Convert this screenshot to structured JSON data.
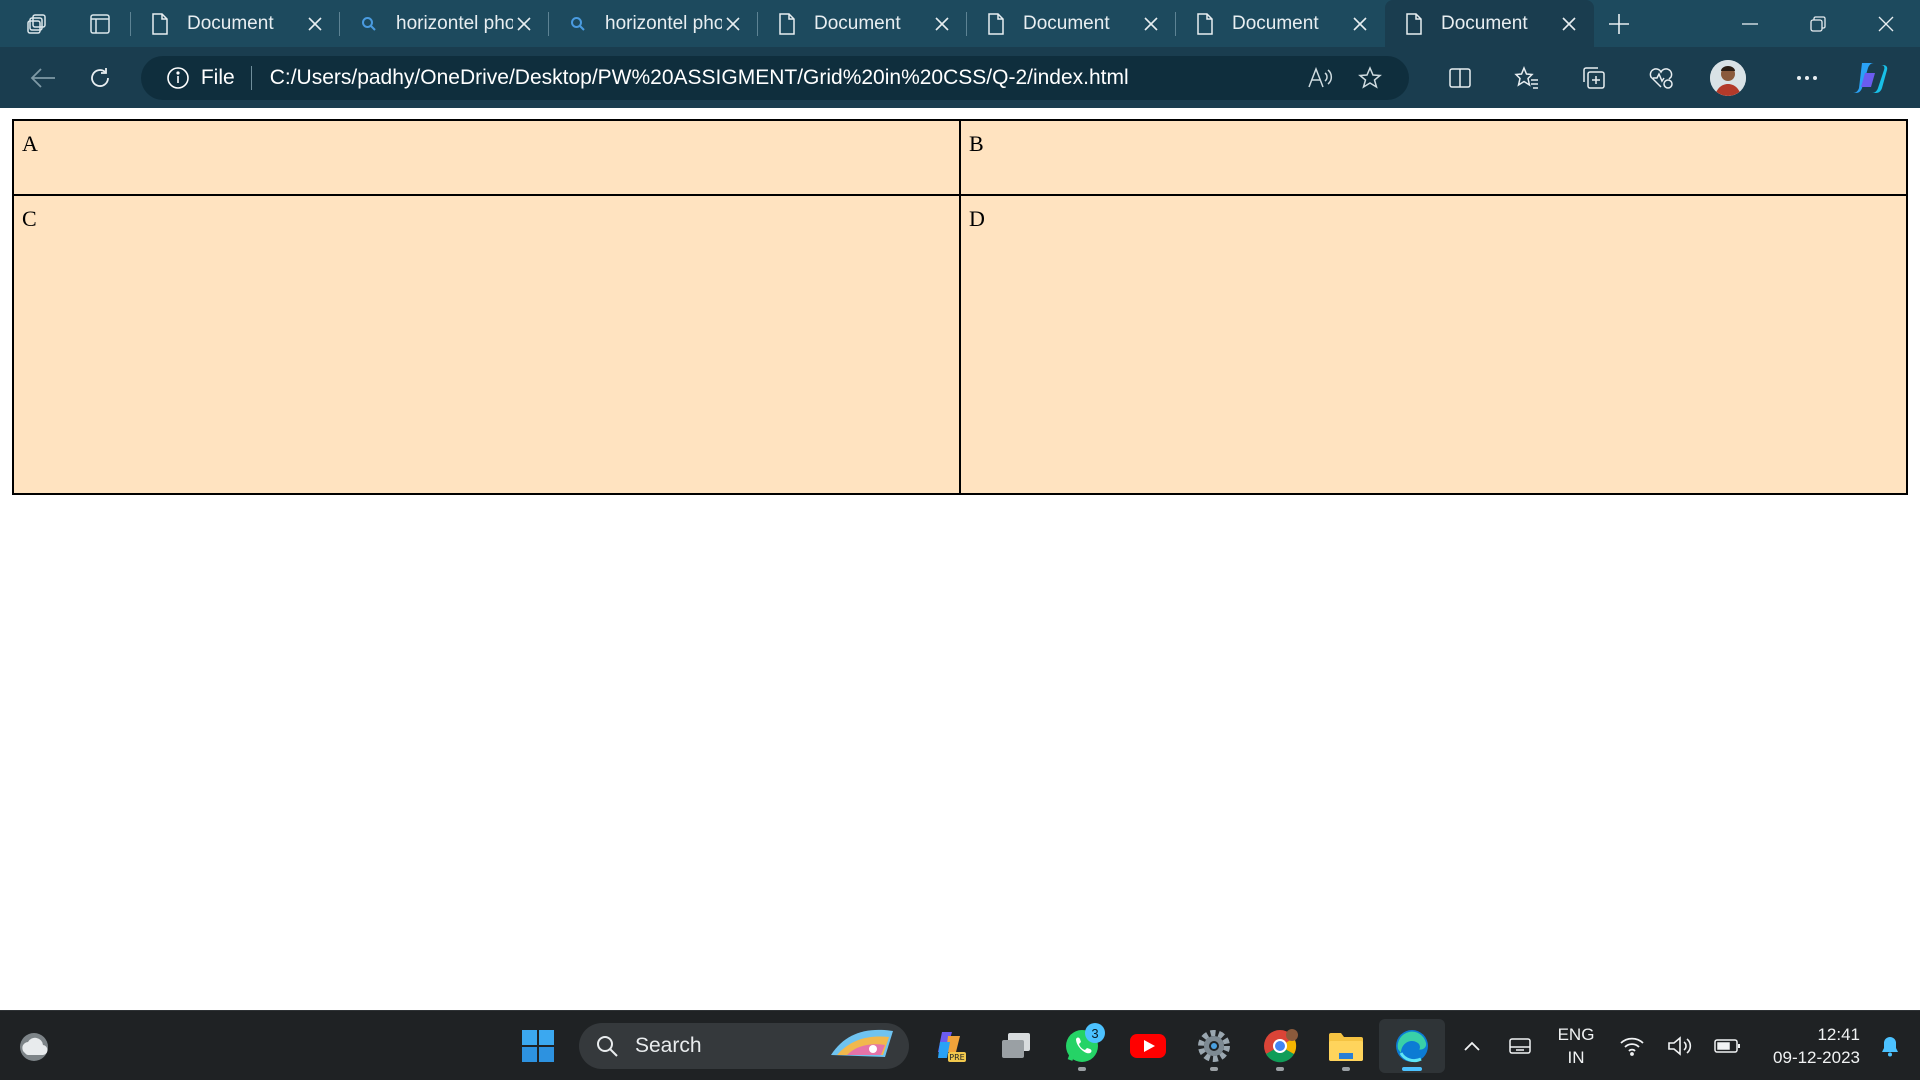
{
  "tabs": [
    {
      "label": "Document",
      "icon": "page-icon",
      "active": false
    },
    {
      "label": "horizontel photos",
      "icon": "search-icon",
      "active": false
    },
    {
      "label": "horizontel photos",
      "icon": "search-icon",
      "active": false
    },
    {
      "label": "Document",
      "icon": "page-icon",
      "active": false
    },
    {
      "label": "Document",
      "icon": "page-icon",
      "active": false
    },
    {
      "label": "Document",
      "icon": "page-icon",
      "active": false
    },
    {
      "label": "Document",
      "icon": "page-icon",
      "active": true
    }
  ],
  "address": {
    "scheme_label": "File",
    "url": "C:/Users/padhy/OneDrive/Desktop/PW%20ASSIGMENT/Grid%20in%20CSS/Q-2/index.html"
  },
  "grid": {
    "cells": [
      "A",
      "B",
      "C",
      "D"
    ],
    "cell_background": "#ffe3c0",
    "border_color": "#000000"
  },
  "taskbar": {
    "search_placeholder": "Search",
    "whatsapp_badge": "3",
    "language": "ENG",
    "region": "IN",
    "time": "12:41",
    "date": "09-12-2023"
  },
  "colors": {
    "tabstrip": "#1d4a5e",
    "toolbar": "#1a3d4f",
    "taskbar": "#1f2224",
    "accent": "#4cc2ff"
  }
}
